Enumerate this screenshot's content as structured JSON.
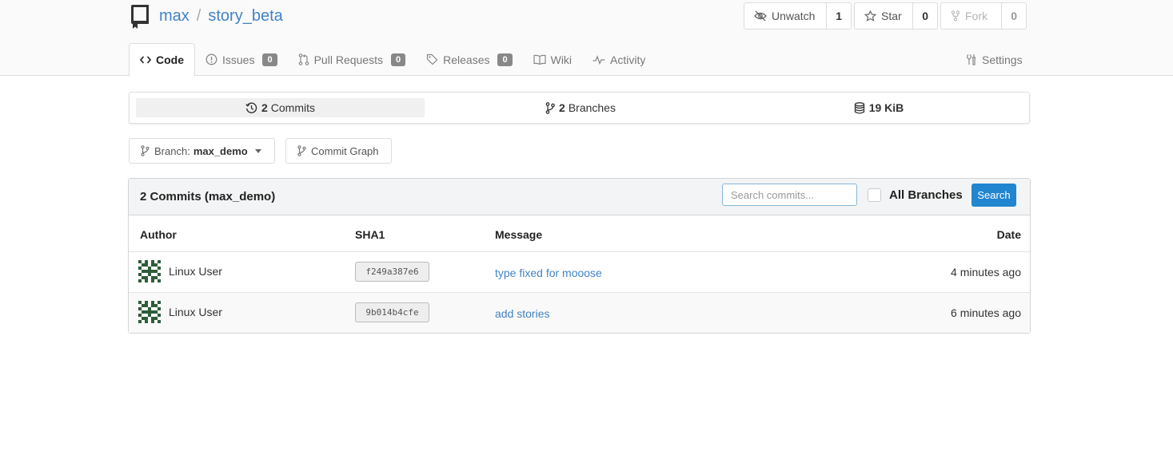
{
  "repo": {
    "owner": "max",
    "separator": "/",
    "name": "story_beta"
  },
  "actions": {
    "watch": {
      "label": "Unwatch",
      "count": "1"
    },
    "star": {
      "label": "Star",
      "count": "0"
    },
    "fork": {
      "label": "Fork",
      "count": "0"
    }
  },
  "tabs": [
    {
      "label": "Code",
      "icon": "code-icon"
    },
    {
      "label": "Issues",
      "badge": "0",
      "icon": "issue-icon"
    },
    {
      "label": "Pull Requests",
      "badge": "0",
      "icon": "pull-request-icon"
    },
    {
      "label": "Releases",
      "badge": "0",
      "icon": "tag-icon"
    },
    {
      "label": "Wiki",
      "icon": "book-icon"
    },
    {
      "label": "Activity",
      "icon": "pulse-icon"
    }
  ],
  "settings": {
    "label": "Settings",
    "icon": "tools-icon"
  },
  "stats": {
    "commits": {
      "count": "2",
      "label": "Commits"
    },
    "branches": {
      "count": "2",
      "label": "Branches"
    },
    "size": {
      "value": "19 KiB"
    }
  },
  "branch": {
    "prefix": "Branch:",
    "name": "max_demo"
  },
  "commit_graph": {
    "label": "Commit Graph"
  },
  "commits_panel": {
    "title": "2 Commits (max_demo)",
    "search_placeholder": "Search commits...",
    "all_branches_label": "All Branches",
    "search_button": "Search",
    "columns": {
      "author": "Author",
      "sha": "SHA1",
      "message": "Message",
      "date": "Date"
    },
    "rows": [
      {
        "author": "Linux User",
        "sha": "f249a387e6",
        "message": "type fixed for mooose",
        "date": "4 minutes ago"
      },
      {
        "author": "Linux User",
        "sha": "9b014b4cfe",
        "message": "add stories",
        "date": "6 minutes ago"
      }
    ]
  },
  "colors": {
    "link": "#4183c4",
    "primary_button": "#2185d0",
    "badge": "#888888"
  }
}
